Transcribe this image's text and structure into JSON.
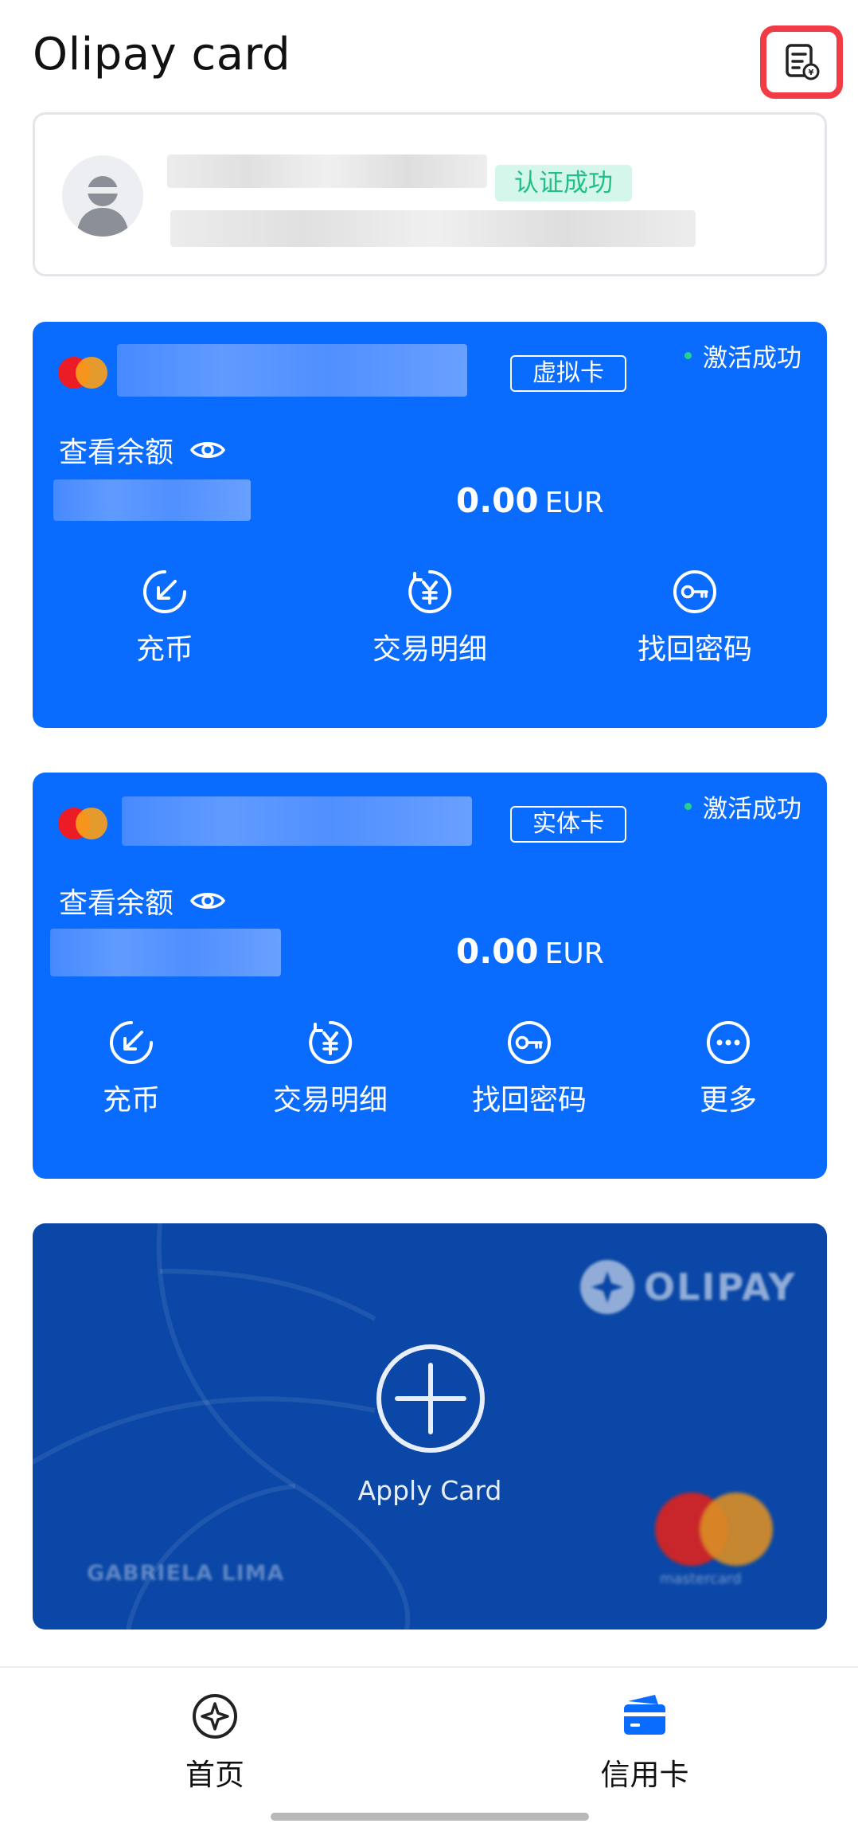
{
  "header": {
    "title": "Olipay card",
    "bill_icon": "bill-icon"
  },
  "user": {
    "verified_label": "认证成功",
    "avatar_icon": "avatar-placeholder-icon"
  },
  "cards": [
    {
      "type_label": "虚拟卡",
      "status": "激活成功",
      "balance_label": "查看余额",
      "amount": "0.00",
      "currency": "EUR",
      "actions": [
        {
          "label": "充币",
          "icon": "deposit-icon"
        },
        {
          "label": "交易明细",
          "icon": "yuan-icon"
        },
        {
          "label": "找回密码",
          "icon": "key-icon"
        }
      ]
    },
    {
      "type_label": "实体卡",
      "status": "激活成功",
      "balance_label": "查看余额",
      "amount": "0.00",
      "currency": "EUR",
      "actions": [
        {
          "label": "充币",
          "icon": "deposit-icon"
        },
        {
          "label": "交易明细",
          "icon": "yuan-icon"
        },
        {
          "label": "找回密码",
          "icon": "key-icon"
        },
        {
          "label": "更多",
          "icon": "more-icon"
        }
      ]
    }
  ],
  "apply_card": {
    "label": "Apply Card",
    "brand": "OLIPAY",
    "holder": "GABRIELA LIMA",
    "network": "mastercard"
  },
  "tabbar": {
    "items": [
      {
        "label": "首页",
        "icon": "home-icon",
        "active": false
      },
      {
        "label": "信用卡",
        "icon": "credit-card-icon",
        "active": true
      }
    ]
  },
  "colors": {
    "card_blue": "#0a6cff",
    "apply_blue": "#0a47a6",
    "highlight_red": "#f23b45",
    "verified_green": "#1fbf85",
    "status_dot": "#27d08f",
    "active_tab": "#0a6cff"
  }
}
